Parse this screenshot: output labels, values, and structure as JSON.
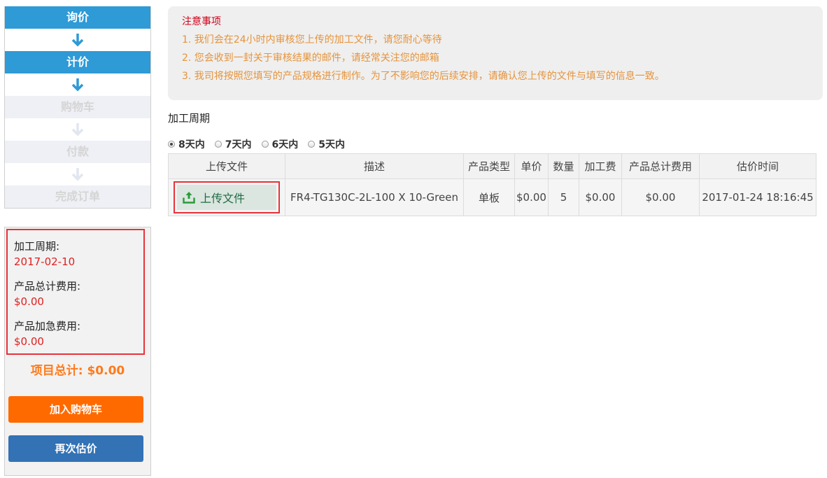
{
  "steps": [
    {
      "label": "询价",
      "state": "active"
    },
    {
      "label": "计价",
      "state": "active"
    },
    {
      "label": "购物车",
      "state": "inactive"
    },
    {
      "label": "付款",
      "state": "inactive"
    },
    {
      "label": "完成订单",
      "state": "inactive"
    }
  ],
  "summary": {
    "cycle_label": "加工周期:",
    "cycle_value": "2017-02-10",
    "total_fee_label": "产品总计费用:",
    "total_fee_value": "$0.00",
    "rush_fee_label": "产品加急费用:",
    "rush_fee_value": "$0.00",
    "project_total": "项目总计: $0.00",
    "add_to_cart": "加入购物车",
    "requote": "再次估价"
  },
  "notice": {
    "title": "注意事项",
    "lines": [
      "1. 我们会在24小时内审核您上传的加工文件，请您耐心等待",
      "2. 您会收到一封关于审核结果的邮件，请经常关注您的邮箱",
      "3. 我司将按照您填写的产品规格进行制作。为了不影响您的后续安排，请确认您上传的文件与填写的信息一致。"
    ]
  },
  "cycle": {
    "title": "加工周期",
    "options": [
      {
        "label": "8天内",
        "checked": true
      },
      {
        "label": "7天内",
        "checked": false
      },
      {
        "label": "6天内",
        "checked": false
      },
      {
        "label": "5天内",
        "checked": false
      }
    ]
  },
  "table": {
    "headers": [
      "上传文件",
      "描述",
      "产品类型",
      "单价",
      "数量",
      "加工费",
      "产品总计费用",
      "估价时间"
    ],
    "row": {
      "upload_label": "上传文件",
      "description": "FR4-TG130C-2L-100 X 10-Green",
      "product_type": "单板",
      "unit_price": "$0.00",
      "quantity": "5",
      "processing_fee": "$0.00",
      "total_fee": "$0.00",
      "quote_time": "2017-01-24 18:16:45"
    }
  },
  "colors": {
    "active_step": "#2e9ad6",
    "cart_button": "#ff6a00",
    "requote_button": "#3372b5",
    "highlight_border": "#e8323a",
    "notice_text": "#e6933b",
    "total_text": "#ff7a1a"
  }
}
